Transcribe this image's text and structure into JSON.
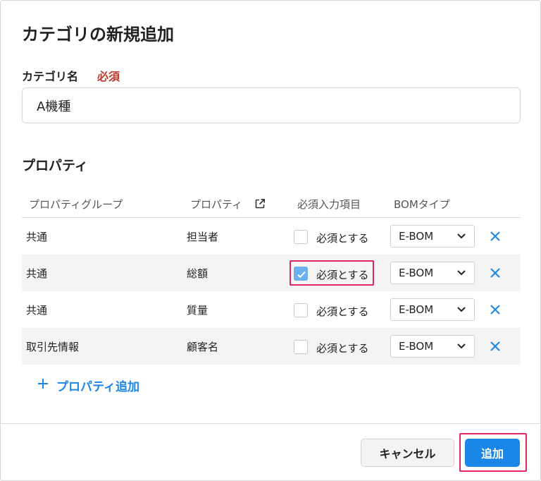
{
  "dialog": {
    "title": "カテゴリの新規追加"
  },
  "category_name": {
    "label": "カテゴリ名",
    "required_label": "必須",
    "value": "A機種"
  },
  "properties": {
    "section_title": "プロパティ",
    "headers": {
      "group": "プロパティグループ",
      "property": "プロパティ",
      "required": "必須入力項目",
      "bom_type": "BOMタイプ"
    },
    "rows": [
      {
        "group": "共通",
        "property": "担当者",
        "required_label": "必須とする",
        "required_checked": false,
        "bom_type": "E-BOM"
      },
      {
        "group": "共通",
        "property": "総額",
        "required_label": "必須とする",
        "required_checked": true,
        "bom_type": "E-BOM"
      },
      {
        "group": "共通",
        "property": "質量",
        "required_label": "必須とする",
        "required_checked": false,
        "bom_type": "E-BOM"
      },
      {
        "group": "取引先情報",
        "property": "顧客名",
        "required_label": "必須とする",
        "required_checked": false,
        "bom_type": "E-BOM"
      }
    ],
    "add_label": "プロパティ追加"
  },
  "footer": {
    "cancel_label": "キャンセル",
    "add_label": "追加"
  },
  "colors": {
    "accent": "#1a86e8",
    "required_text": "#c0392b",
    "highlight_border": "#e0246a",
    "checkbox_checked": "#6cb0ee"
  }
}
